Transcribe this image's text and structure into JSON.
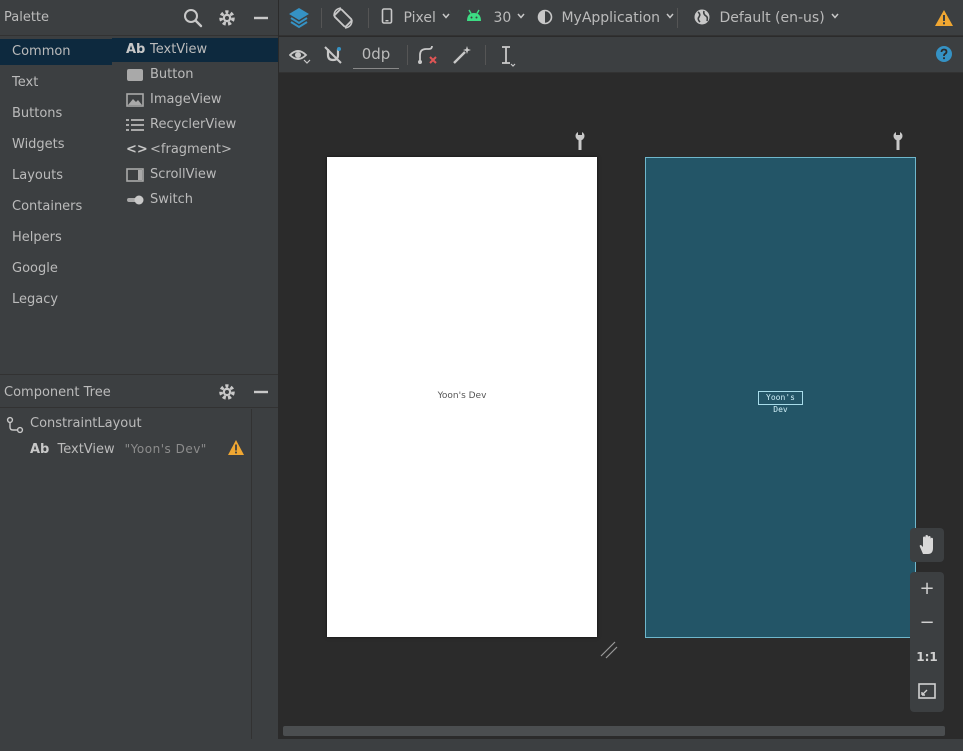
{
  "palette": {
    "title": "Palette",
    "categories": [
      "Common",
      "Text",
      "Buttons",
      "Widgets",
      "Layouts",
      "Containers",
      "Helpers",
      "Google",
      "Legacy"
    ],
    "selected_category": "Common",
    "items": [
      {
        "label": "TextView",
        "icon": "textview-icon",
        "icon_text": "Ab"
      },
      {
        "label": "Button",
        "icon": "button-icon"
      },
      {
        "label": "ImageView",
        "icon": "imageview-icon"
      },
      {
        "label": "RecyclerView",
        "icon": "recyclerview-icon"
      },
      {
        "label": "<fragment>",
        "icon": "fragment-icon",
        "icon_text": "<>"
      },
      {
        "label": "ScrollView",
        "icon": "scrollview-icon"
      },
      {
        "label": "Switch",
        "icon": "switch-icon"
      }
    ]
  },
  "component_tree": {
    "title": "Component Tree",
    "root": "ConstraintLayout",
    "child_icon_text": "Ab",
    "child": "TextView",
    "child_text": "\"Yoon's Dev\""
  },
  "toolbar": {
    "device": "Pixel",
    "api_level": "30",
    "theme": "MyApplication",
    "locale": "Default (en-us)",
    "margin": "0dp"
  },
  "canvas": {
    "design_text": "Yoon's Dev",
    "blueprint_text": "Yoon's Dev"
  },
  "zoom": {
    "zoom_in": "+",
    "zoom_out": "−",
    "actual_size": "1:1"
  },
  "colors": {
    "panel_bg": "#3c3f41",
    "canvas_bg": "#2b2b2b",
    "selection": "#0d293e",
    "blueprint": "#235567",
    "warning": "#f0a732",
    "accent_blue": "#3592c4"
  }
}
